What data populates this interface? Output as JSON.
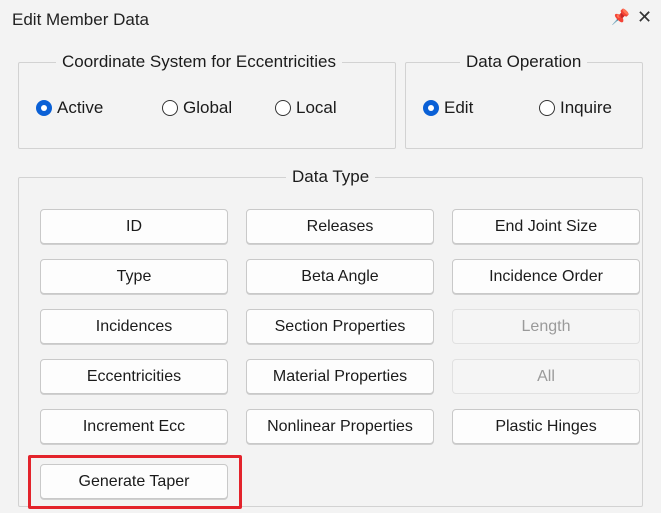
{
  "window": {
    "title": "Edit Member Data",
    "pin_glyph": "□",
    "close_glyph": "✕"
  },
  "coordinate_system": {
    "legend": "Coordinate System for Eccentricities",
    "options": [
      "Active",
      "Global",
      "Local"
    ],
    "selected": "Active"
  },
  "data_operation": {
    "legend": "Data Operation",
    "options": [
      "Edit",
      "Inquire"
    ],
    "selected": "Edit"
  },
  "data_type": {
    "legend": "Data Type",
    "buttons": [
      {
        "label": "ID",
        "enabled": true
      },
      {
        "label": "Releases",
        "enabled": true
      },
      {
        "label": "End Joint Size",
        "enabled": true
      },
      {
        "label": "Type",
        "enabled": true
      },
      {
        "label": "Beta Angle",
        "enabled": true
      },
      {
        "label": "Incidence Order",
        "enabled": true
      },
      {
        "label": "Incidences",
        "enabled": true
      },
      {
        "label": "Section Properties",
        "enabled": true
      },
      {
        "label": "Length",
        "enabled": false
      },
      {
        "label": "Eccentricities",
        "enabled": true
      },
      {
        "label": "Material Properties",
        "enabled": true
      },
      {
        "label": "All",
        "enabled": false
      },
      {
        "label": "Increment Ecc",
        "enabled": true
      },
      {
        "label": "Nonlinear Properties",
        "enabled": true
      },
      {
        "label": "Plastic Hinges",
        "enabled": true
      },
      {
        "label": "Generate Taper",
        "enabled": true
      }
    ]
  },
  "colors": {
    "accent": "#0a60d6",
    "highlight": "#e3232b",
    "panel": "#f3f3f3"
  }
}
